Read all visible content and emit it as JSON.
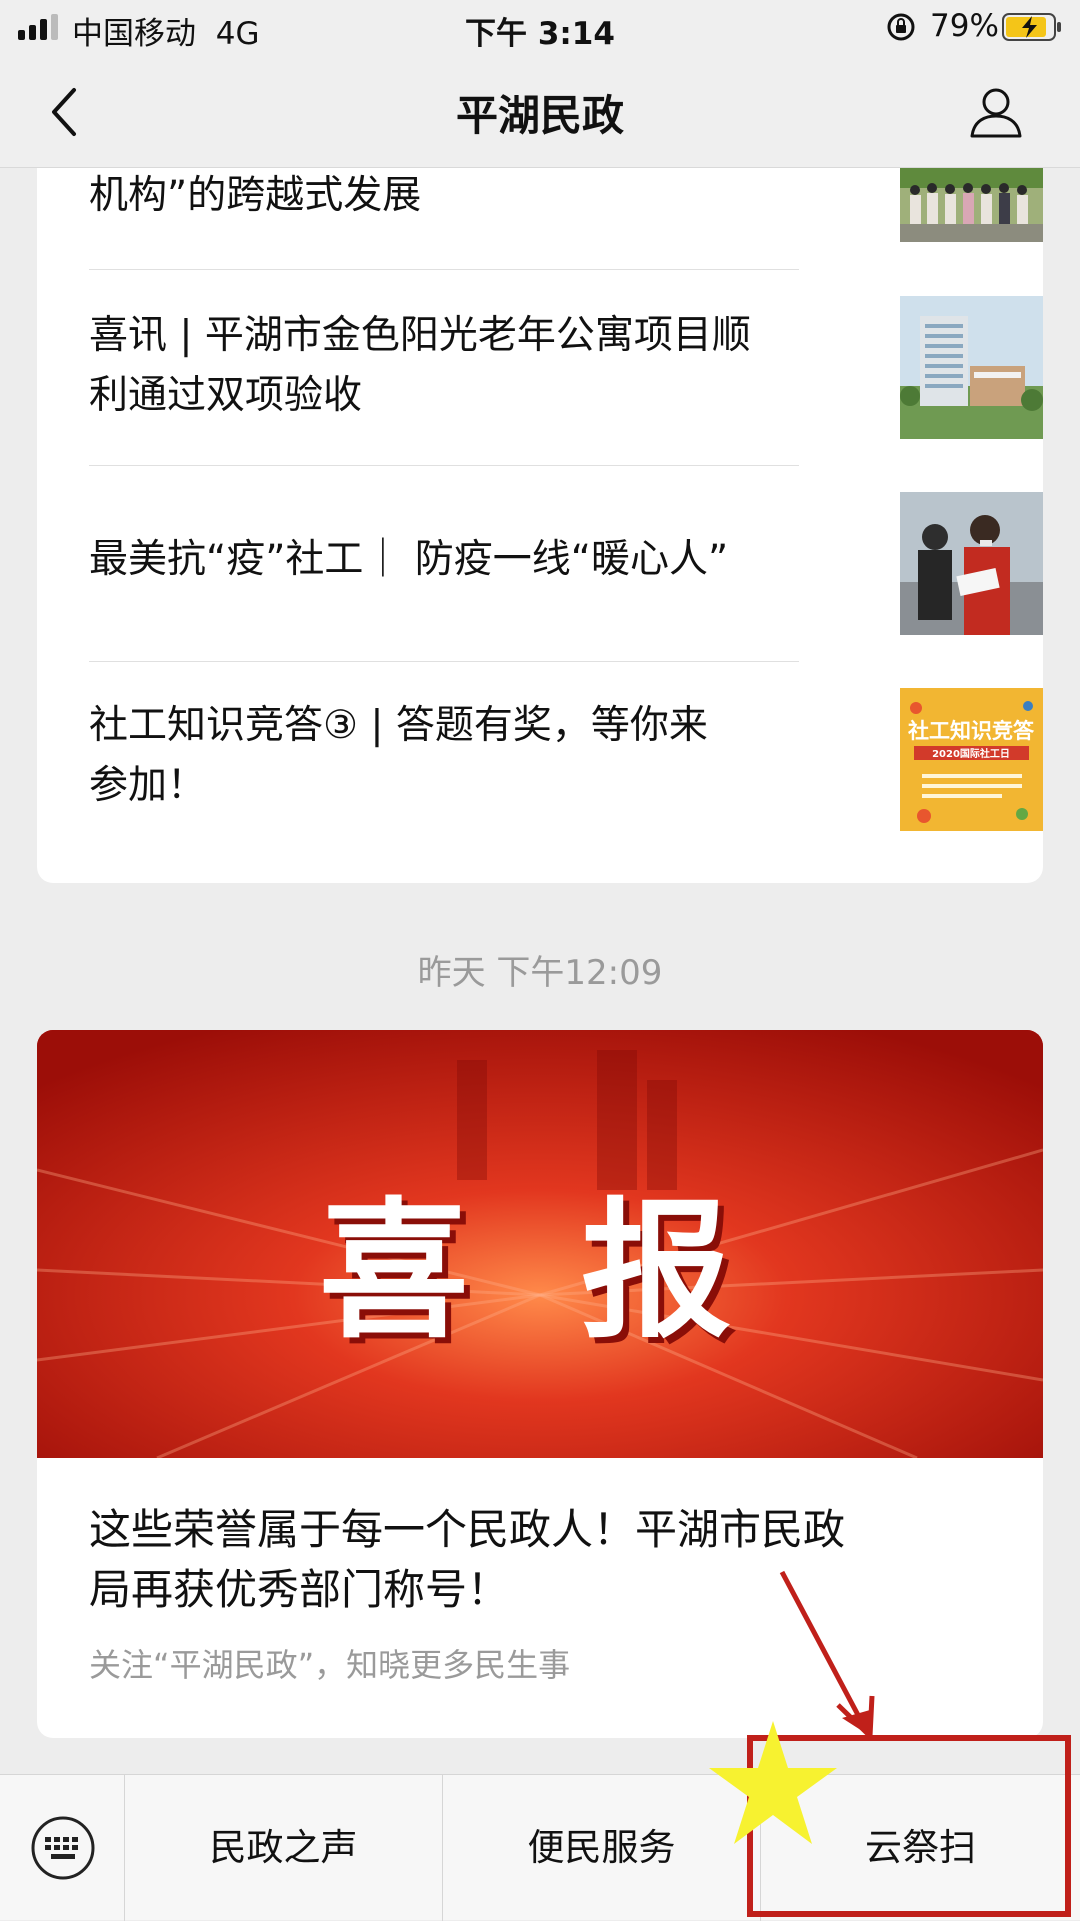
{
  "status": {
    "carrier": "中国移动",
    "network": "4G",
    "time": "下午 3:14",
    "battery": "79%"
  },
  "nav": {
    "title": "平湖民政"
  },
  "articles": [
    {
      "title_line1": "机构”的跨越式发展",
      "title_line2": "",
      "thumb": "group-photo"
    },
    {
      "title_line1": "喜讯 | 平湖市金色阳光老年公寓项目顺",
      "title_line2": "利通过双项验收",
      "thumb": "building-render"
    },
    {
      "title_line1": "最美抗“疫”社工｜ 防疫一线“暖心人”",
      "title_line2": "",
      "thumb": "volunteer-photo"
    },
    {
      "title_line1": "社工知识竞答③ | 答题有奖，等你来",
      "title_line2": "参加！",
      "thumb": "quiz-poster"
    }
  ],
  "thumb_texts": {
    "quiz_title": "社工知识竞答",
    "quiz_sub": "2020国际社工日"
  },
  "timestamp": "昨天 下午12:09",
  "feature": {
    "hero_text": "喜 报",
    "headline_line1": "这些荣誉属于每一个民政人！平湖市民政",
    "headline_line2": "局再获优秀部门称号！",
    "subtitle": "关注“平湖民政”，知晓更多民生事"
  },
  "menu": {
    "tabs": [
      "民政之声",
      "便民服务",
      "云祭扫"
    ]
  },
  "colors": {
    "annotation_red": "#c0201a",
    "star_yellow": "#f7f230",
    "hero_red": "#c41a10"
  }
}
